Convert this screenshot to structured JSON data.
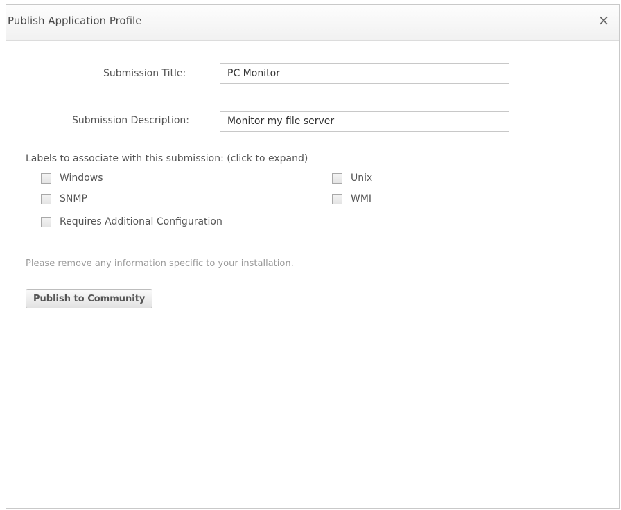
{
  "dialog": {
    "title": "Publish Application Profile",
    "close_symbol": "×"
  },
  "form": {
    "title_label": "Submission Title:",
    "title_value": "PC Monitor",
    "description_label": "Submission Description:",
    "description_value": "Monitor my file server"
  },
  "labels_section": {
    "heading": "Labels to associate with this submission: (click to expand)",
    "options": [
      {
        "label": "Windows",
        "checked": false
      },
      {
        "label": "Unix",
        "checked": false
      },
      {
        "label": "SNMP",
        "checked": false
      },
      {
        "label": "WMI",
        "checked": false
      },
      {
        "label": "Requires Additional Configuration",
        "checked": false
      }
    ]
  },
  "hint_text": "Please remove any information specific to your installation.",
  "publish_button_label": "Publish to Community"
}
